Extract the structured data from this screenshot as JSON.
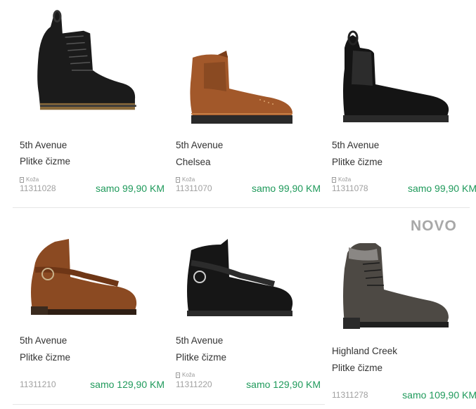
{
  "badge": "NOVO",
  "products": [
    {
      "brand": "5th Avenue",
      "name": "Plitke čizme",
      "material": "Koža",
      "sku": "11311028",
      "price": "samo 99,90 KM",
      "image_icon": "black-lace-up-boot"
    },
    {
      "brand": "5th Avenue",
      "name": "Chelsea",
      "material": "Koža",
      "sku": "11311070",
      "price": "samo 99,90 KM",
      "image_icon": "brown-chelsea-boot"
    },
    {
      "brand": "5th Avenue",
      "name": "Plitke čizme",
      "material": "Koža",
      "sku": "11311078",
      "price": "samo 99,90 KM",
      "image_icon": "black-chelsea-boot"
    },
    {
      "brand": "5th Avenue",
      "name": "Plitke čizme",
      "material": "",
      "sku": "11311210",
      "price": "samo 129,90 KM",
      "image_icon": "brown-buckle-boot"
    },
    {
      "brand": "5th Avenue",
      "name": "Plitke čizme",
      "material": "Koža",
      "sku": "11311220",
      "price": "samo 129,90 KM",
      "image_icon": "black-buckle-boot"
    },
    {
      "brand": "Highland Creek",
      "name": "Plitke čizme",
      "material": "",
      "sku": "11311278",
      "price": "samo 109,90 KM",
      "image_icon": "grey-lace-up-boot"
    }
  ],
  "colors": {
    "price": "#1f9a5b",
    "muted": "#a0a0a0",
    "divider": "#e6e6e6"
  }
}
